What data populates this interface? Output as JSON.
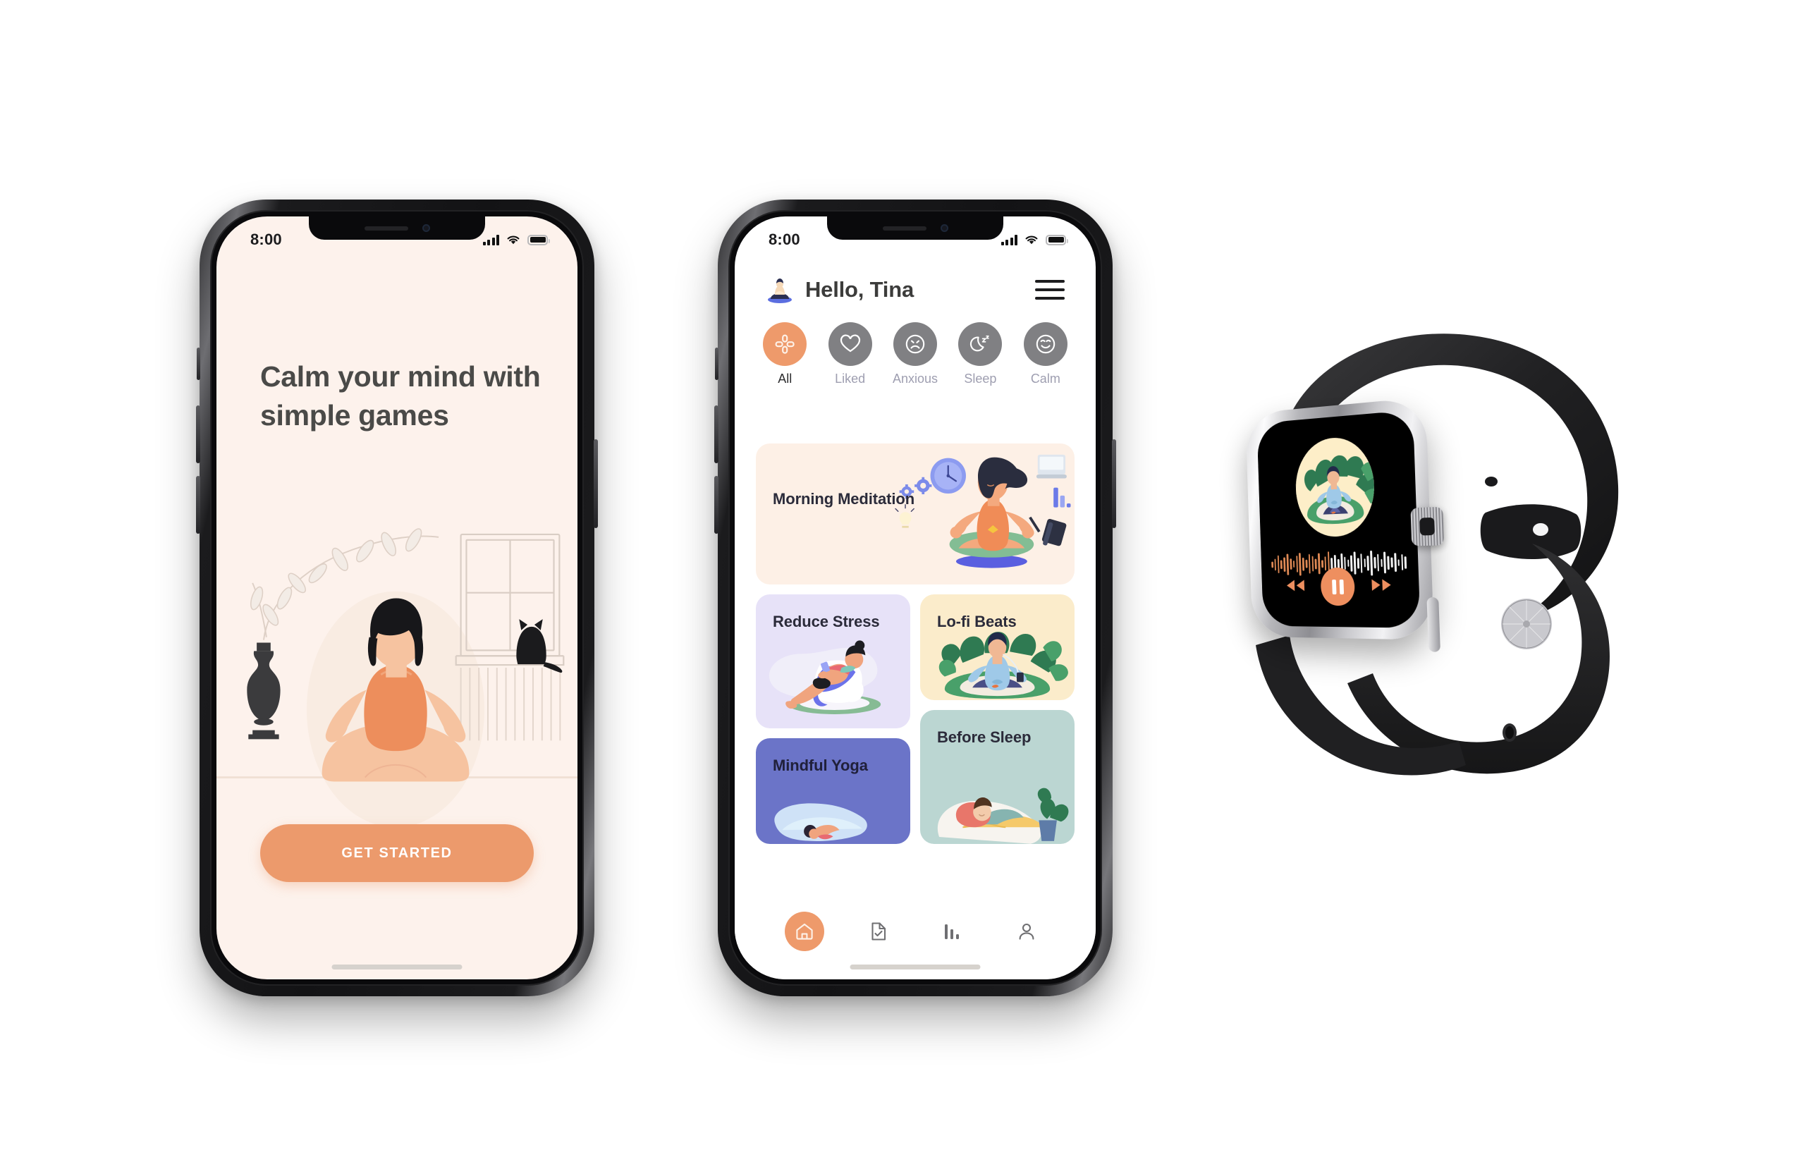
{
  "scene": {
    "background_color": "#ffffff",
    "devices": [
      "iphone-onboarding",
      "iphone-home",
      "apple-watch-player"
    ]
  },
  "phone_onboarding": {
    "status_bar": {
      "time": "8:00",
      "signal_icon": "signal-bars-icon",
      "wifi_icon": "wifi-icon",
      "battery_icon": "battery-icon"
    },
    "heading": "Calm your mind with simple games",
    "illustration": "woman-meditating-with-cat-illustration",
    "cta_label": "GET STARTED",
    "screen_bg": "#fdf2ec",
    "accent": "#ec9a6c",
    "heading_color": "#4a4a48"
  },
  "phone_home": {
    "status_bar": {
      "time": "8:00",
      "signal_icon": "signal-bars-icon",
      "wifi_icon": "wifi-icon",
      "battery_icon": "battery-icon"
    },
    "header": {
      "avatar_icon": "meditating-avatar-icon",
      "greeting": "Hello, Tina",
      "menu_icon": "hamburger-menu-icon"
    },
    "categories": [
      {
        "label": "All",
        "icon": "pinwheel-grid-icon",
        "active": true,
        "color": "#ee9a6b"
      },
      {
        "label": "Liked",
        "icon": "heart-icon",
        "active": false,
        "color": "#808083"
      },
      {
        "label": "Anxious",
        "icon": "frowning-face-icon",
        "active": false,
        "color": "#808083"
      },
      {
        "label": "Sleep",
        "icon": "moon-zzz-icon",
        "active": false,
        "color": "#808083"
      },
      {
        "label": "Calm",
        "icon": "smiling-face-icon",
        "active": false,
        "color": "#808083"
      }
    ],
    "cards": [
      {
        "title": "Morning Meditation",
        "bg": "#fdf0e6",
        "illustration": "woman-meditating-productivity-icons"
      },
      {
        "title": "Reduce Stress",
        "bg": "#e7e2f8",
        "illustration": "woman-relaxing-in-armchair"
      },
      {
        "title": "Lo-fi Beats",
        "bg": "#fbeccb",
        "illustration": "person-meditating-with-headphones-plants"
      },
      {
        "title": "Mindful Yoga",
        "bg": "#6b74c8",
        "illustration": "person-lying-on-yoga-mat"
      },
      {
        "title": "Before Sleep",
        "bg": "#bbd6d2",
        "illustration": "person-sleeping-in-bed-with-plant"
      }
    ],
    "tabs": [
      {
        "icon": "home-icon",
        "active": true
      },
      {
        "icon": "document-check-icon",
        "active": false
      },
      {
        "icon": "bar-chart-icon",
        "active": false
      },
      {
        "icon": "profile-icon",
        "active": false
      }
    ],
    "screen_bg": "#ffffff",
    "accent": "#ee9a6b"
  },
  "watch": {
    "screen_bg": "#000000",
    "album_art": "person-meditating-with-plants-icon",
    "album_art_bg": "#fdeec8",
    "waveform": {
      "played_color": "#e08a55",
      "remaining_color": "#f2f2f2",
      "progress_percent": 45
    },
    "controls": [
      {
        "icon": "rewind-icon",
        "label": "Rewind"
      },
      {
        "icon": "pause-icon",
        "label": "Pause"
      },
      {
        "icon": "forward-icon",
        "label": "Forward"
      }
    ],
    "accent": "#ee8f5f",
    "case_finish": "stainless-steel",
    "band_color": "#232325"
  }
}
